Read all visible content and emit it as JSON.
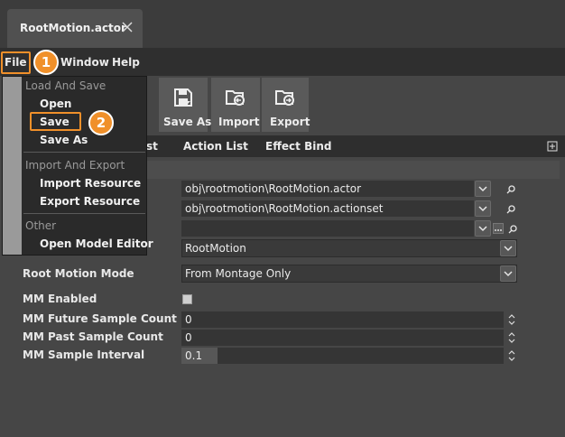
{
  "window": {
    "tab_title": "RootMotion.actor"
  },
  "menubar": {
    "file": "File",
    "window": "Window",
    "help": "Help"
  },
  "annotations": {
    "step1": "1",
    "step2": "2"
  },
  "toolbar": {
    "save_as": "Save As",
    "import": "Import",
    "export": "Export"
  },
  "subtabs": {
    "partial": "st",
    "action_list": "Action List",
    "effect_bind": "Effect Bind"
  },
  "file_menu": {
    "section_load_save": "Load And Save",
    "open": "Open",
    "save": "Save",
    "save_as": "Save As",
    "section_import_export": "Import And Export",
    "import_resource": "Import Resource",
    "export_resource": "Export Resource",
    "section_other": "Other",
    "open_model_editor": "Open Model Editor"
  },
  "properties": {
    "actor_path": "obj\\rootmotion\\RootMotion.actor",
    "actionset_path": "obj\\rootmotion\\RootMotion.actionset",
    "third_path": "",
    "rootmotion_value": "RootMotion",
    "root_motion_mode_label": "Root Motion Mode",
    "root_motion_mode_value": "From Montage Only",
    "mm_enabled_label": "MM Enabled",
    "mm_future_label": "MM Future Sample Count",
    "mm_future_value": "0",
    "mm_past_label": "MM Past Sample Count",
    "mm_past_value": "0",
    "mm_interval_label": "MM Sample Interval",
    "mm_interval_value": "0.1"
  },
  "colors": {
    "accent": "#f0902a",
    "background": "#464646",
    "menu": "#2a2a2a"
  },
  "icons": [
    "close-icon",
    "save-as-icon",
    "import-icon",
    "export-icon",
    "pin-icon",
    "search-icon",
    "chevron-down-icon",
    "ellipsis-icon",
    "spin-icon"
  ]
}
